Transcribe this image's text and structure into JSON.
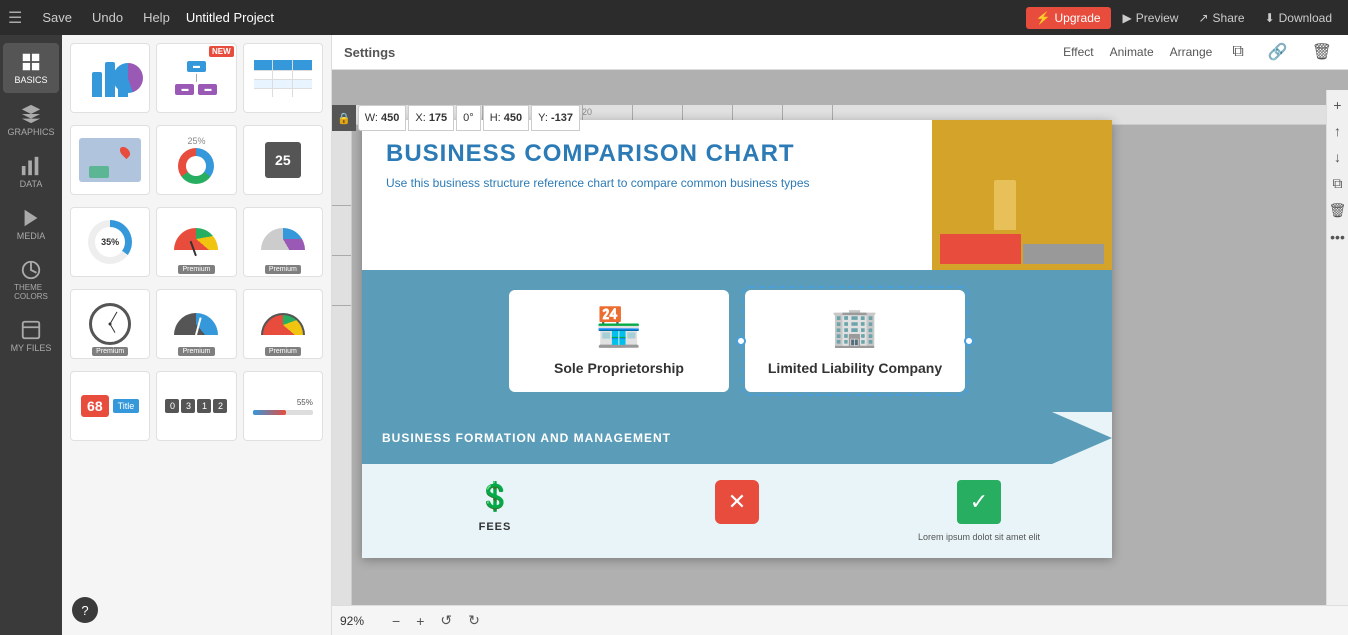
{
  "topbar": {
    "menu_icon": "☰",
    "save_label": "Save",
    "undo_label": "Undo",
    "help_label": "Help",
    "project_title": "Untitled Project",
    "upgrade_label": "Upgrade",
    "preview_label": "Preview",
    "share_label": "Share",
    "download_label": "Download"
  },
  "sidebar": {
    "items": [
      {
        "id": "basics",
        "label": "BASICS",
        "icon": "⊞"
      },
      {
        "id": "graphics",
        "label": "GRAPHICS",
        "icon": "✦"
      },
      {
        "id": "data",
        "label": "DATA",
        "icon": "▦"
      },
      {
        "id": "media",
        "label": "MEDIA",
        "icon": "▷"
      },
      {
        "id": "theme-colors",
        "label": "THEME COLORS",
        "icon": "◉"
      },
      {
        "id": "my-files",
        "label": "MY FILES",
        "icon": "⊟"
      }
    ]
  },
  "settings_bar": {
    "title": "Settings",
    "effect_label": "Effect",
    "animate_label": "Animate",
    "arrange_label": "Arrange"
  },
  "transform": {
    "width_label": "W:",
    "width_value": "450",
    "height_label": "H:",
    "height_value": "450",
    "x_label": "X:",
    "x_value": "175",
    "y_label": "Y:",
    "y_value": "-137",
    "rotation_value": "0°"
  },
  "canvas": {
    "title": "BUSINESS COMPARISON CHART",
    "subtitle": "Use this business structure reference chart to compare common business types",
    "cards": [
      {
        "title": "Sole Proprietorship",
        "icon": "🏪"
      },
      {
        "title": "Limited Liability Company",
        "icon": "🏢"
      }
    ],
    "formation_section": {
      "title": "BUSINESS FORMATION AND MANAGEMENT",
      "fees_label": "FEES",
      "lorem_text": "Lorem ipsum dolot sit amet elit"
    }
  },
  "zoom": {
    "value": "92%"
  },
  "help": {
    "label": "?"
  }
}
